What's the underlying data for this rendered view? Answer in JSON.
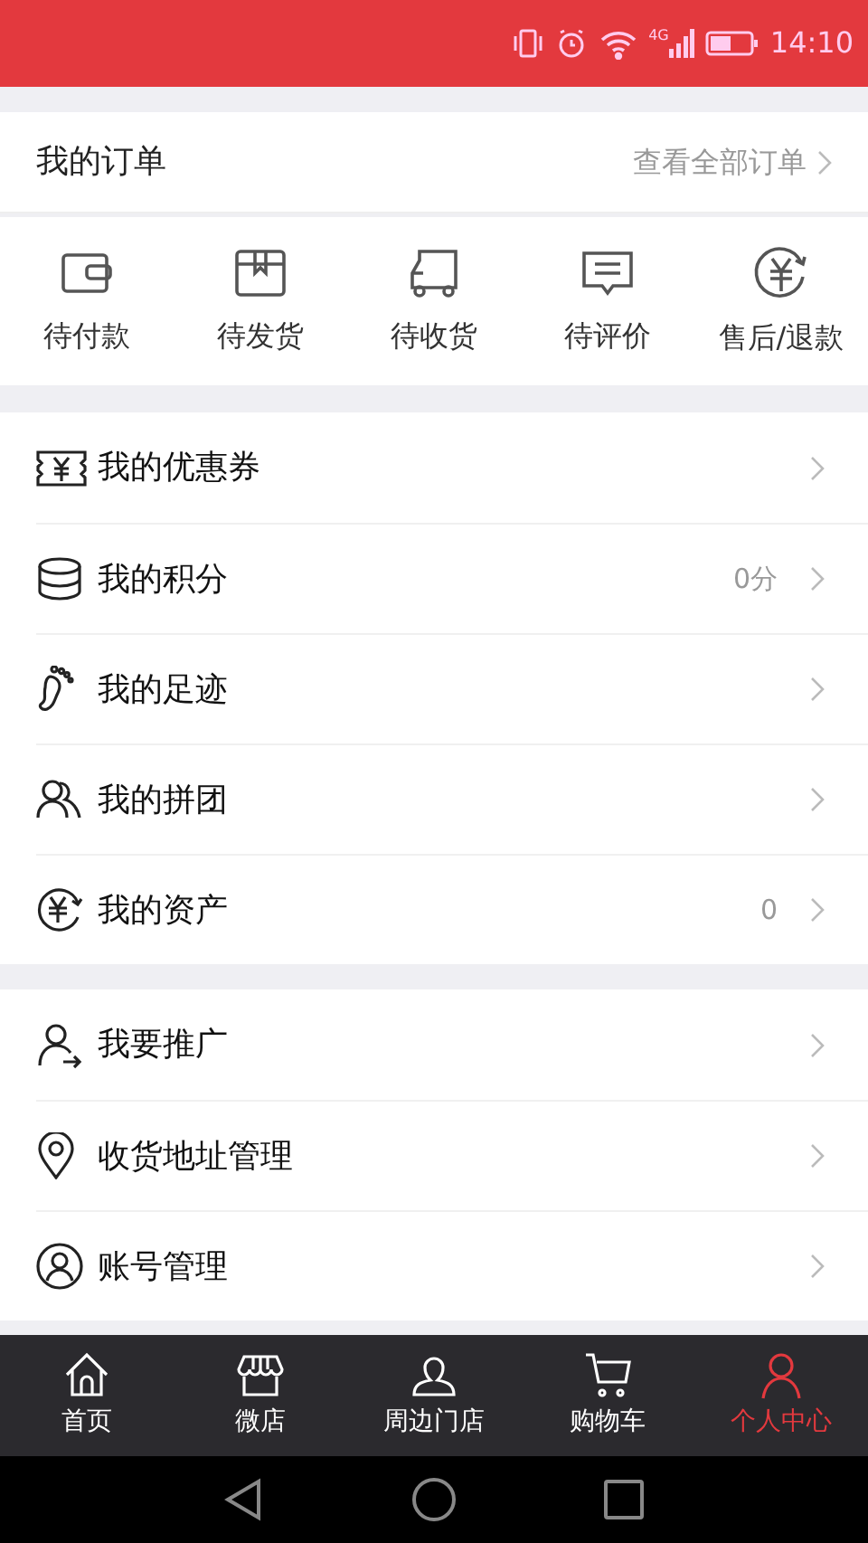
{
  "status_bar": {
    "network": "4G",
    "time": "14:10"
  },
  "orders": {
    "title": "我的订单",
    "link": "查看全部订单",
    "shortcuts": [
      {
        "label": "待付款"
      },
      {
        "label": "待发货"
      },
      {
        "label": "待收货"
      },
      {
        "label": "待评价"
      },
      {
        "label": "售后/退款"
      }
    ]
  },
  "menu_groups": [
    {
      "items": [
        {
          "label": "我的优惠券"
        },
        {
          "label": "我的积分",
          "value": "0分"
        },
        {
          "label": "我的足迹"
        },
        {
          "label": "我的拼团"
        },
        {
          "label": "我的资产",
          "value": "0"
        }
      ]
    },
    {
      "items": [
        {
          "label": "我要推广"
        },
        {
          "label": "收货地址管理"
        },
        {
          "label": "账号管理"
        }
      ]
    }
  ],
  "tab_bar": [
    {
      "label": "首页",
      "selected": false
    },
    {
      "label": "微店",
      "selected": false
    },
    {
      "label": "周边门店",
      "selected": false
    },
    {
      "label": "购物车",
      "selected": false
    },
    {
      "label": "个人中心",
      "selected": true
    }
  ]
}
